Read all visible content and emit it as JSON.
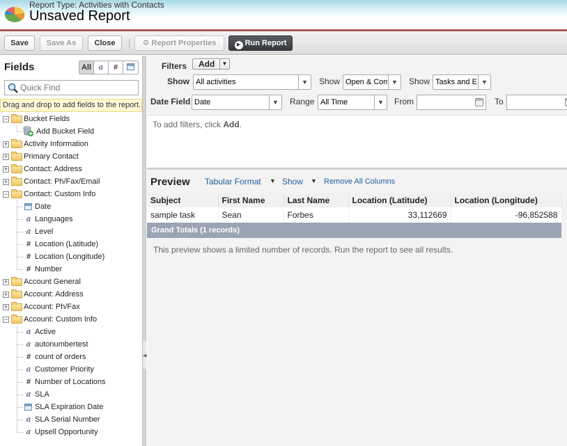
{
  "header": {
    "subtitle": "Report Type: Activities with Contacts",
    "title": "Unsaved Report",
    "accent_color": "#a85a50"
  },
  "toolbar": {
    "save_label": "Save",
    "save_as_label": "Save As",
    "close_label": "Close",
    "report_properties_label": "Report Properties",
    "run_report_label": "Run Report"
  },
  "sidebar": {
    "title": "Fields",
    "type_filters": [
      "All",
      "a",
      "#",
      "date"
    ],
    "quickfind_placeholder": "Quick Find",
    "hint": "Drag and drop to add fields to the report.",
    "tree": [
      {
        "label": "Bucket Fields",
        "expanded": true,
        "children": [
          {
            "label": "Add Bucket Field",
            "type": "bucket"
          }
        ]
      },
      {
        "label": "Activity Information",
        "expanded": false
      },
      {
        "label": "Primary Contact",
        "expanded": false
      },
      {
        "label": "Contact: Address",
        "expanded": false
      },
      {
        "label": "Contact: Ph/Fax/Email",
        "expanded": false
      },
      {
        "label": "Contact: Custom Info",
        "expanded": true,
        "children": [
          {
            "label": "Date",
            "type": "date"
          },
          {
            "label": "Languages",
            "type": "text"
          },
          {
            "label": "Level",
            "type": "text"
          },
          {
            "label": "Location (Latitude)",
            "type": "number"
          },
          {
            "label": "Location (Longitude)",
            "type": "number"
          },
          {
            "label": "Number",
            "type": "number"
          }
        ]
      },
      {
        "label": "Account General",
        "expanded": false
      },
      {
        "label": "Account: Address",
        "expanded": false
      },
      {
        "label": "Account: Ph/Fax",
        "expanded": false
      },
      {
        "label": "Account: Custom Info",
        "expanded": true,
        "children": [
          {
            "label": "Active",
            "type": "text"
          },
          {
            "label": "autonumbertest",
            "type": "text"
          },
          {
            "label": "count of orders",
            "type": "number"
          },
          {
            "label": "Customer Priority",
            "type": "text"
          },
          {
            "label": "Number of Locations",
            "type": "number"
          },
          {
            "label": "SLA",
            "type": "text"
          },
          {
            "label": "SLA Expiration Date",
            "type": "date"
          },
          {
            "label": "SLA Serial Number",
            "type": "text"
          },
          {
            "label": "Upsell Opportunity",
            "type": "text"
          }
        ]
      }
    ]
  },
  "filters": {
    "filters_label": "Filters",
    "add_label": "Add",
    "show_label": "Show",
    "show_value": "All activities",
    "show2_label": "Show",
    "show2_value": "Open & Com",
    "show3_label": "Show",
    "show3_value": "Tasks and E",
    "date_field_label": "Date Field",
    "date_field_value": "Date",
    "range_label": "Range",
    "range_value": "All Time",
    "from_label": "From",
    "from_value": "",
    "to_label": "To",
    "to_value": "",
    "empty_msg_prefix": "To add filters, click ",
    "empty_msg_bold": "Add",
    "empty_msg_suffix": "."
  },
  "preview": {
    "title": "Preview",
    "format_label": "Tabular Format",
    "show_label": "Show",
    "remove_all_label": "Remove All Columns",
    "columns": [
      "Subject",
      "First Name",
      "Last Name",
      "Location (Latitude)",
      "Location (Longitude)"
    ],
    "rows": [
      [
        "sample task",
        "Sean",
        "Forbes",
        "33,112669",
        "-96,852588"
      ]
    ],
    "grand_totals": "Grand Totals (1 records)",
    "note": "This preview shows a limited number of records. Run the report to see all results."
  }
}
